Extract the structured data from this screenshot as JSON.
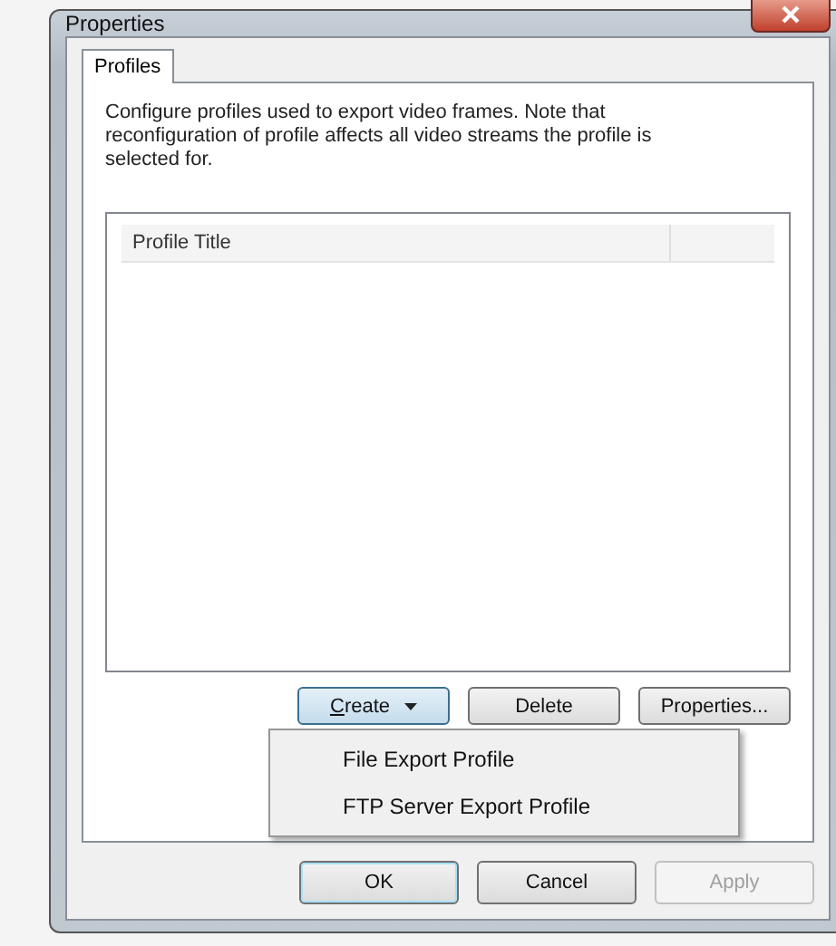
{
  "window": {
    "title": "Properties"
  },
  "tabs": [
    {
      "label": "Profiles",
      "selected": true
    }
  ],
  "description": "Configure profiles used to export video frames. Note that reconfiguration of profile affects all video streams the profile is selected for.",
  "table": {
    "columns": [
      "Profile Title"
    ]
  },
  "buttons": [
    {
      "label": "Create",
      "kind": "split",
      "mnemonic": true,
      "expanded": true
    },
    {
      "label": "Delete",
      "kind": "plain",
      "mnemonic": false,
      "expanded": false
    },
    {
      "label": "Properties...",
      "kind": "plain",
      "mnemonic": false,
      "expanded": false
    }
  ],
  "menu": {
    "items": [
      "File Export Profile",
      "FTP Server Export Profile"
    ]
  },
  "dialog_buttons": [
    {
      "label": "OK",
      "default": true,
      "disabled": false
    },
    {
      "label": "Cancel",
      "default": false,
      "disabled": false
    },
    {
      "label": "Apply",
      "default": false,
      "disabled": true
    }
  ]
}
